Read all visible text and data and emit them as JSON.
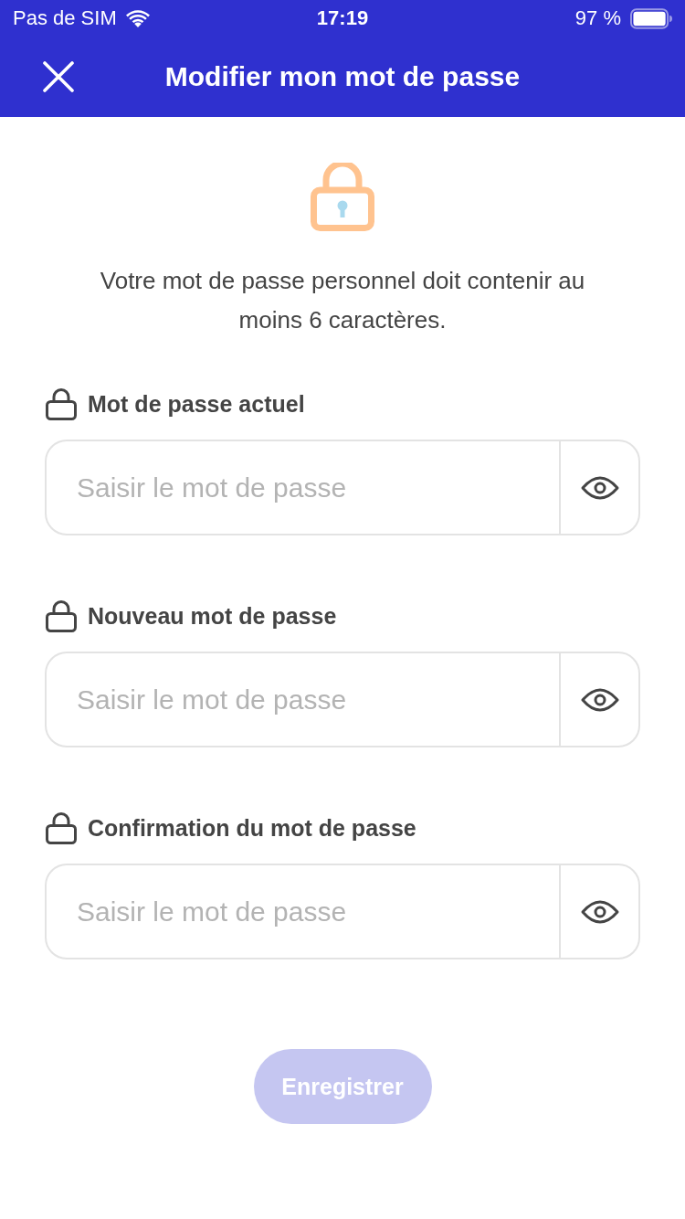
{
  "status_bar": {
    "carrier": "Pas de SIM",
    "time": "17:19",
    "battery": "97 %"
  },
  "header": {
    "title": "Modifier mon mot de passe"
  },
  "intro": "Votre mot de passe personnel doit contenir au moins 6 caractères.",
  "fields": [
    {
      "label": "Mot de passe actuel",
      "placeholder": "Saisir le mot de passe"
    },
    {
      "label": "Nouveau mot de passe",
      "placeholder": "Saisir le mot de passe"
    },
    {
      "label": "Confirmation du mot de passe",
      "placeholder": "Saisir le mot de passe"
    }
  ],
  "save_button": {
    "label": "Enregistrer",
    "disabled": true
  }
}
